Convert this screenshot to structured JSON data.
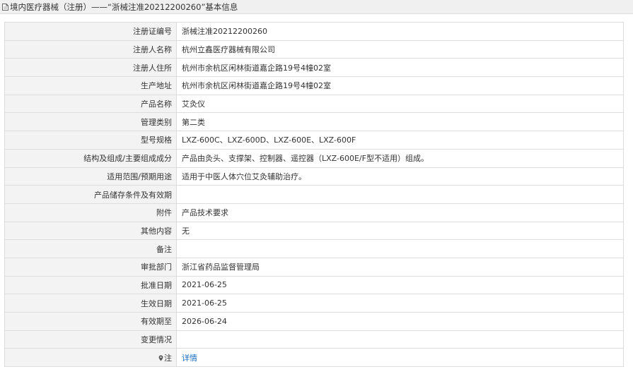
{
  "header": {
    "icon": "document-icon",
    "title": "境内医疗器械（注册）——“浙械注准20212200260”基本信息"
  },
  "rows": [
    {
      "label": "注册证编号",
      "value": "浙械注准20212200260"
    },
    {
      "label": "注册人名称",
      "value": "杭州立鑫医疗器械有限公司"
    },
    {
      "label": "注册人住所",
      "value": "杭州市余杭区闲林街道嘉企路19号4幢02室"
    },
    {
      "label": "生产地址",
      "value": "杭州市余杭区闲林街道嘉企路19号4幢02室"
    },
    {
      "label": "产品名称",
      "value": "艾灸仪"
    },
    {
      "label": "管理类别",
      "value": "第二类"
    },
    {
      "label": "型号规格",
      "value": "LXZ-600C、LXZ-600D、LXZ-600E、LXZ-600F"
    },
    {
      "label": "结构及组成/主要组成成分",
      "value": "产品由灸头、支撑架、控制器、遥控器（LXZ-600E/F型不适用）组成。"
    },
    {
      "label": "适用范围/预期用途",
      "value": "适用于中医人体穴位艾灸辅助治疗。"
    },
    {
      "label": "产品储存条件及有效期",
      "value": ""
    },
    {
      "label": "附件",
      "value": "产品技术要求"
    },
    {
      "label": "其他内容",
      "value": "无"
    },
    {
      "label": "备注",
      "value": ""
    },
    {
      "label": "审批部门",
      "value": "浙江省药品监督管理局"
    },
    {
      "label": "批准日期",
      "value": "2021-06-25"
    },
    {
      "label": "生效日期",
      "value": "2021-06-25"
    },
    {
      "label": "有效期至",
      "value": "2026-06-24"
    },
    {
      "label": "变更情况",
      "value": ""
    }
  ],
  "note_row": {
    "icon": "pin-icon",
    "label": "注",
    "link_text": "详情",
    "link_color": "#1a6fc4"
  }
}
